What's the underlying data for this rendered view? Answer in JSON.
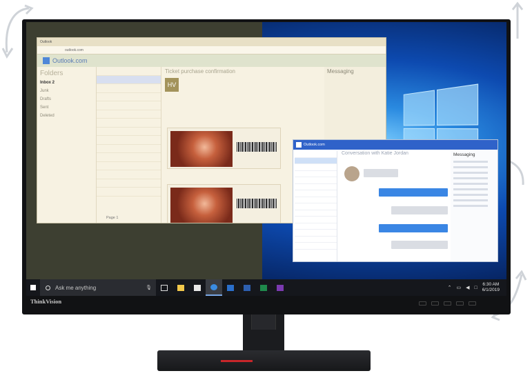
{
  "brand": "ThinkVision",
  "browser": {
    "title": "Outlook",
    "address": "outlook.com",
    "app_name": "Outlook.com"
  },
  "mail": {
    "folders_header": "Folders",
    "folders": [
      "Inbox 2",
      "Junk",
      "Drafts",
      "Sent",
      "Deleted"
    ],
    "reading_subject": "Ticket purchase confirmation",
    "sender_initials": "HV",
    "pagination": "Page 1",
    "messaging_header": "Messaging"
  },
  "outlook2": {
    "app_name": "Outlook.com",
    "conversation_subject": "Conversation with Katie Jordan",
    "messaging_header": "Messaging"
  },
  "taskbar": {
    "search_placeholder": "Ask me anything",
    "time": "6:30 AM",
    "date": "6/1/2019"
  },
  "colors": {
    "outlook_blue": "#2f62c9",
    "stand_accent": "#c8262a",
    "taskbar": "#15171c"
  },
  "icons": [
    "rotate-arrow-icon",
    "windows-start-icon",
    "cortana-circle-icon",
    "microphone-icon",
    "task-view-icon",
    "file-explorer-icon",
    "store-icon",
    "edge-icon",
    "outlook-icon",
    "calendar-icon",
    "excel-icon",
    "onenote-icon",
    "chevron-up-icon",
    "network-icon",
    "volume-icon",
    "notification-icon"
  ]
}
